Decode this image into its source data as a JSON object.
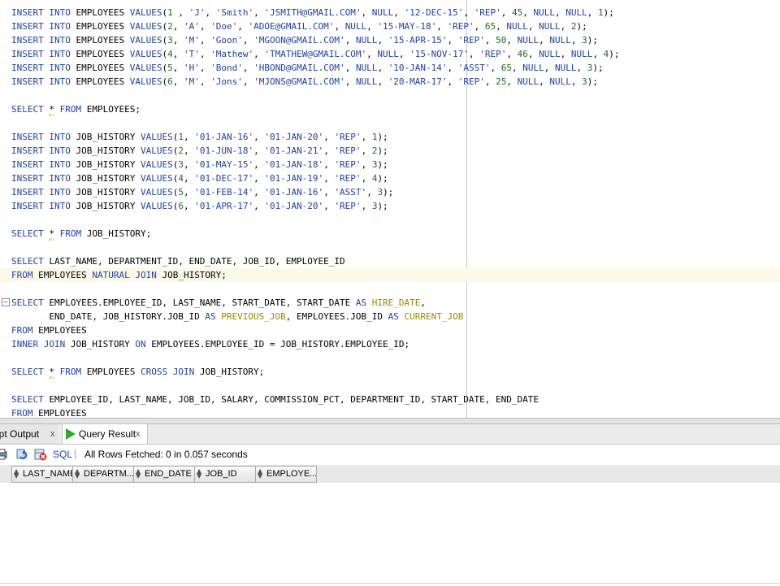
{
  "editor": {
    "lines": [
      [
        [
          "kw",
          "INSERT INTO "
        ],
        [
          "",
          "EMPLOYEES "
        ],
        [
          "kw",
          "VALUES"
        ],
        [
          "",
          "("
        ],
        [
          "num",
          "1"
        ],
        [
          "",
          " , "
        ],
        [
          "str",
          "'J'"
        ],
        [
          "",
          ", "
        ],
        [
          "str",
          "'Smith'"
        ],
        [
          "",
          ", "
        ],
        [
          "str",
          "'JSMITH@GMAIL.COM'"
        ],
        [
          "",
          ", "
        ],
        [
          "kw",
          "NULL"
        ],
        [
          "",
          ", "
        ],
        [
          "str",
          "'12-DEC-15'"
        ],
        [
          "",
          ", "
        ],
        [
          "str",
          "'REP'"
        ],
        [
          "",
          ", "
        ],
        [
          "num",
          "45"
        ],
        [
          "",
          ", "
        ],
        [
          "kw",
          "NULL"
        ],
        [
          "",
          ", "
        ],
        [
          "kw",
          "NULL"
        ],
        [
          "",
          ", "
        ],
        [
          "num",
          "1"
        ],
        [
          "",
          ");"
        ]
      ],
      [
        [
          "kw",
          "INSERT INTO "
        ],
        [
          "",
          "EMPLOYEES "
        ],
        [
          "kw",
          "VALUES"
        ],
        [
          "",
          "("
        ],
        [
          "num",
          "2"
        ],
        [
          "",
          ", "
        ],
        [
          "str",
          "'A'"
        ],
        [
          "",
          ", "
        ],
        [
          "str",
          "'Doe'"
        ],
        [
          "",
          ", "
        ],
        [
          "str",
          "'ADOE@GMAIL.COM'"
        ],
        [
          "",
          ", "
        ],
        [
          "kw",
          "NULL"
        ],
        [
          "",
          ", "
        ],
        [
          "str",
          "'15-MAY-18'"
        ],
        [
          "",
          ", "
        ],
        [
          "str",
          "'REP'"
        ],
        [
          "",
          ", "
        ],
        [
          "num",
          "65"
        ],
        [
          "",
          ", "
        ],
        [
          "kw",
          "NULL"
        ],
        [
          "",
          ", "
        ],
        [
          "kw",
          "NULL"
        ],
        [
          "",
          ", "
        ],
        [
          "num",
          "2"
        ],
        [
          "",
          ");"
        ]
      ],
      [
        [
          "kw",
          "INSERT INTO "
        ],
        [
          "",
          "EMPLOYEES "
        ],
        [
          "kw",
          "VALUES"
        ],
        [
          "",
          "("
        ],
        [
          "num",
          "3"
        ],
        [
          "",
          ", "
        ],
        [
          "str",
          "'M'"
        ],
        [
          "",
          ", "
        ],
        [
          "str",
          "'Goon'"
        ],
        [
          "",
          ", "
        ],
        [
          "str",
          "'MGOON@GMAIL.COM'"
        ],
        [
          "",
          ", "
        ],
        [
          "kw",
          "NULL"
        ],
        [
          "",
          ", "
        ],
        [
          "str",
          "'15-APR-15'"
        ],
        [
          "",
          ", "
        ],
        [
          "str",
          "'REP'"
        ],
        [
          "",
          ", "
        ],
        [
          "num",
          "50"
        ],
        [
          "",
          ", "
        ],
        [
          "kw",
          "NULL"
        ],
        [
          "",
          ", "
        ],
        [
          "kw",
          "NULL"
        ],
        [
          "",
          ", "
        ],
        [
          "num",
          "3"
        ],
        [
          "",
          ");"
        ]
      ],
      [
        [
          "kw",
          "INSERT INTO "
        ],
        [
          "",
          "EMPLOYEES "
        ],
        [
          "kw",
          "VALUES"
        ],
        [
          "",
          "("
        ],
        [
          "num",
          "4"
        ],
        [
          "",
          ", "
        ],
        [
          "str",
          "'T'"
        ],
        [
          "",
          ", "
        ],
        [
          "str",
          "'Mathew'"
        ],
        [
          "",
          ", "
        ],
        [
          "str",
          "'TMATHEW@GMAIL.COM'"
        ],
        [
          "",
          ", "
        ],
        [
          "kw",
          "NULL"
        ],
        [
          "",
          ", "
        ],
        [
          "str",
          "'15-NOV-17'"
        ],
        [
          "",
          ", "
        ],
        [
          "str",
          "'REP'"
        ],
        [
          "",
          ", "
        ],
        [
          "num",
          "46"
        ],
        [
          "",
          ", "
        ],
        [
          "kw",
          "NULL"
        ],
        [
          "",
          ", "
        ],
        [
          "kw",
          "NULL"
        ],
        [
          "",
          ", "
        ],
        [
          "num",
          "4"
        ],
        [
          "",
          ");"
        ]
      ],
      [
        [
          "kw",
          "INSERT INTO "
        ],
        [
          "",
          "EMPLOYEES "
        ],
        [
          "kw",
          "VALUES"
        ],
        [
          "",
          "("
        ],
        [
          "num",
          "5"
        ],
        [
          "",
          ", "
        ],
        [
          "str",
          "'H'"
        ],
        [
          "",
          ", "
        ],
        [
          "str",
          "'Bond'"
        ],
        [
          "",
          ", "
        ],
        [
          "str",
          "'HBOND@GMAIL.COM'"
        ],
        [
          "",
          ", "
        ],
        [
          "kw",
          "NULL"
        ],
        [
          "",
          ", "
        ],
        [
          "str",
          "'10-JAN-14'"
        ],
        [
          "",
          ", "
        ],
        [
          "str",
          "'ASST'"
        ],
        [
          "",
          ", "
        ],
        [
          "num",
          "65"
        ],
        [
          "",
          ", "
        ],
        [
          "kw",
          "NULL"
        ],
        [
          "",
          ", "
        ],
        [
          "kw",
          "NULL"
        ],
        [
          "",
          ", "
        ],
        [
          "num",
          "3"
        ],
        [
          "",
          ");"
        ]
      ],
      [
        [
          "kw",
          "INSERT INTO "
        ],
        [
          "",
          "EMPLOYEES "
        ],
        [
          "kw",
          "VALUES"
        ],
        [
          "",
          "("
        ],
        [
          "num",
          "6"
        ],
        [
          "",
          ", "
        ],
        [
          "str",
          "'M'"
        ],
        [
          "",
          ", "
        ],
        [
          "str",
          "'Jons'"
        ],
        [
          "",
          ", "
        ],
        [
          "str",
          "'MJONS@GMAIL.COM'"
        ],
        [
          "",
          ", "
        ],
        [
          "kw",
          "NULL"
        ],
        [
          "",
          ", "
        ],
        [
          "str",
          "'20-MAR-17'"
        ],
        [
          "",
          ", "
        ],
        [
          "str",
          "'REP'"
        ],
        [
          "",
          ", "
        ],
        [
          "num",
          "25"
        ],
        [
          "",
          ", "
        ],
        [
          "kw",
          "NULL"
        ],
        [
          "",
          ", "
        ],
        [
          "kw",
          "NULL"
        ],
        [
          "",
          ", "
        ],
        [
          "num",
          "3"
        ],
        [
          "",
          ");"
        ]
      ],
      [],
      [
        [
          "kw",
          "SELECT "
        ],
        [
          "star",
          "*"
        ],
        [
          "kw",
          " FROM "
        ],
        [
          "",
          "EMPLOYEES;"
        ]
      ],
      [],
      [
        [
          "kw",
          "INSERT INTO "
        ],
        [
          "",
          "JOB_HISTORY "
        ],
        [
          "kw",
          "VALUES"
        ],
        [
          "",
          "("
        ],
        [
          "num",
          "1"
        ],
        [
          "",
          ", "
        ],
        [
          "str",
          "'01-JAN-16'"
        ],
        [
          "",
          ", "
        ],
        [
          "str",
          "'01-JAN-20'"
        ],
        [
          "",
          ", "
        ],
        [
          "str",
          "'REP'"
        ],
        [
          "",
          ", "
        ],
        [
          "num",
          "1"
        ],
        [
          "",
          ");"
        ]
      ],
      [
        [
          "kw",
          "INSERT INTO "
        ],
        [
          "",
          "JOB_HISTORY "
        ],
        [
          "kw",
          "VALUES"
        ],
        [
          "",
          "("
        ],
        [
          "num",
          "2"
        ],
        [
          "",
          ", "
        ],
        [
          "str",
          "'01-JUN-18'"
        ],
        [
          "",
          ", "
        ],
        [
          "str",
          "'01-JAN-21'"
        ],
        [
          "",
          ", "
        ],
        [
          "str",
          "'REP'"
        ],
        [
          "",
          ", "
        ],
        [
          "num",
          "2"
        ],
        [
          "",
          ");"
        ]
      ],
      [
        [
          "kw",
          "INSERT INTO "
        ],
        [
          "",
          "JOB_HISTORY "
        ],
        [
          "kw",
          "VALUES"
        ],
        [
          "",
          "("
        ],
        [
          "num",
          "3"
        ],
        [
          "",
          ", "
        ],
        [
          "str",
          "'01-MAY-15'"
        ],
        [
          "",
          ", "
        ],
        [
          "str",
          "'01-JAN-18'"
        ],
        [
          "",
          ", "
        ],
        [
          "str",
          "'REP'"
        ],
        [
          "",
          ", "
        ],
        [
          "num",
          "3"
        ],
        [
          "",
          ");"
        ]
      ],
      [
        [
          "kw",
          "INSERT INTO "
        ],
        [
          "",
          "JOB_HISTORY "
        ],
        [
          "kw",
          "VALUES"
        ],
        [
          "",
          "("
        ],
        [
          "num",
          "4"
        ],
        [
          "",
          ", "
        ],
        [
          "str",
          "'01-DEC-17'"
        ],
        [
          "",
          ", "
        ],
        [
          "str",
          "'01-JAN-19'"
        ],
        [
          "",
          ", "
        ],
        [
          "str",
          "'REP'"
        ],
        [
          "",
          ", "
        ],
        [
          "num",
          "4"
        ],
        [
          "",
          ");"
        ]
      ],
      [
        [
          "kw",
          "INSERT INTO "
        ],
        [
          "",
          "JOB_HISTORY "
        ],
        [
          "kw",
          "VALUES"
        ],
        [
          "",
          "("
        ],
        [
          "num",
          "5"
        ],
        [
          "",
          ", "
        ],
        [
          "str",
          "'01-FEB-14'"
        ],
        [
          "",
          ", "
        ],
        [
          "str",
          "'01-JAN-16'"
        ],
        [
          "",
          ", "
        ],
        [
          "str",
          "'ASST'"
        ],
        [
          "",
          ", "
        ],
        [
          "num",
          "3"
        ],
        [
          "",
          ");"
        ]
      ],
      [
        [
          "kw",
          "INSERT INTO "
        ],
        [
          "",
          "JOB_HISTORY "
        ],
        [
          "kw",
          "VALUES"
        ],
        [
          "",
          "("
        ],
        [
          "num",
          "6"
        ],
        [
          "",
          ", "
        ],
        [
          "str",
          "'01-APR-17'"
        ],
        [
          "",
          ", "
        ],
        [
          "str",
          "'01-JAN-20'"
        ],
        [
          "",
          ", "
        ],
        [
          "str",
          "'REP'"
        ],
        [
          "",
          ", "
        ],
        [
          "num",
          "3"
        ],
        [
          "",
          ");"
        ]
      ],
      [],
      [
        [
          "kw",
          "SELECT "
        ],
        [
          "star",
          "*"
        ],
        [
          "kw",
          " FROM "
        ],
        [
          "",
          "JOB_HISTORY;"
        ]
      ],
      [],
      [
        [
          "kw",
          "SELECT "
        ],
        [
          "",
          "LAST_NAME, DEPARTMENT_ID, END_DATE, JOB_ID, EMPLOYEE_ID"
        ]
      ],
      [
        [
          "kw",
          "FROM "
        ],
        [
          "",
          "EMPLOYEES "
        ],
        [
          "kw",
          "NATURAL JOIN "
        ],
        [
          "",
          "JOB_HISTORY;"
        ]
      ],
      [],
      [
        [
          "kw",
          "SELECT "
        ],
        [
          "",
          "EMPLOYEES.EMPLOYEE_ID, LAST_NAME, START_DATE, START_DATE "
        ],
        [
          "kw",
          "AS "
        ],
        [
          "alias",
          "HIRE_DATE"
        ],
        [
          "",
          ","
        ]
      ],
      [
        [
          "",
          "       END_DATE, JOB_HISTORY.JOB_ID "
        ],
        [
          "kw",
          "AS "
        ],
        [
          "alias",
          "PREVIOUS_JOB"
        ],
        [
          "",
          ", EMPLOYEES.JOB_ID "
        ],
        [
          "kw",
          "AS "
        ],
        [
          "alias",
          "CURRENT_JOB"
        ]
      ],
      [
        [
          "kw",
          "FROM "
        ],
        [
          "",
          "EMPLOYEES"
        ]
      ],
      [
        [
          "kw",
          "INNER JOIN "
        ],
        [
          "",
          "JOB_HISTORY "
        ],
        [
          "kw",
          "ON "
        ],
        [
          "",
          "EMPLOYEES.EMPLOYEE_ID = JOB_HISTORY.EMPLOYEE_ID;"
        ]
      ],
      [],
      [
        [
          "kw",
          "SELECT "
        ],
        [
          "star",
          "*"
        ],
        [
          "kw",
          " FROM "
        ],
        [
          "",
          "EMPLOYEES "
        ],
        [
          "kw",
          "CROSS JOIN "
        ],
        [
          "",
          "JOB_HISTORY;"
        ]
      ],
      [],
      [
        [
          "kw",
          "SELECT "
        ],
        [
          "",
          "EMPLOYEE_ID, LAST_NAME, JOB_ID, SALARY, COMMISSION_PCT, DEPARTMENT_ID, START_DATE, END_DATE"
        ]
      ],
      [
        [
          "kw",
          "FROM "
        ],
        [
          "",
          "EMPLOYEES"
        ]
      ]
    ]
  },
  "tabs": {
    "script_output": "ript Output",
    "script_close": "x",
    "query_result": "Query Result",
    "query_close": "x"
  },
  "toolbar": {
    "sql_label": "SQL",
    "status": "All Rows Fetched: 0 in 0.057 seconds"
  },
  "grid": {
    "columns": [
      "LAST_NAME",
      "DEPARTM...",
      "END_DATE",
      "JOB_ID",
      "EMPLOYE..."
    ]
  },
  "colors": {
    "keyword": "#1f3fa8",
    "number": "#1b6f1b",
    "alias": "#9a8a00",
    "current_line": "#fdf9e8",
    "run_icon": "#2eaa2e"
  }
}
